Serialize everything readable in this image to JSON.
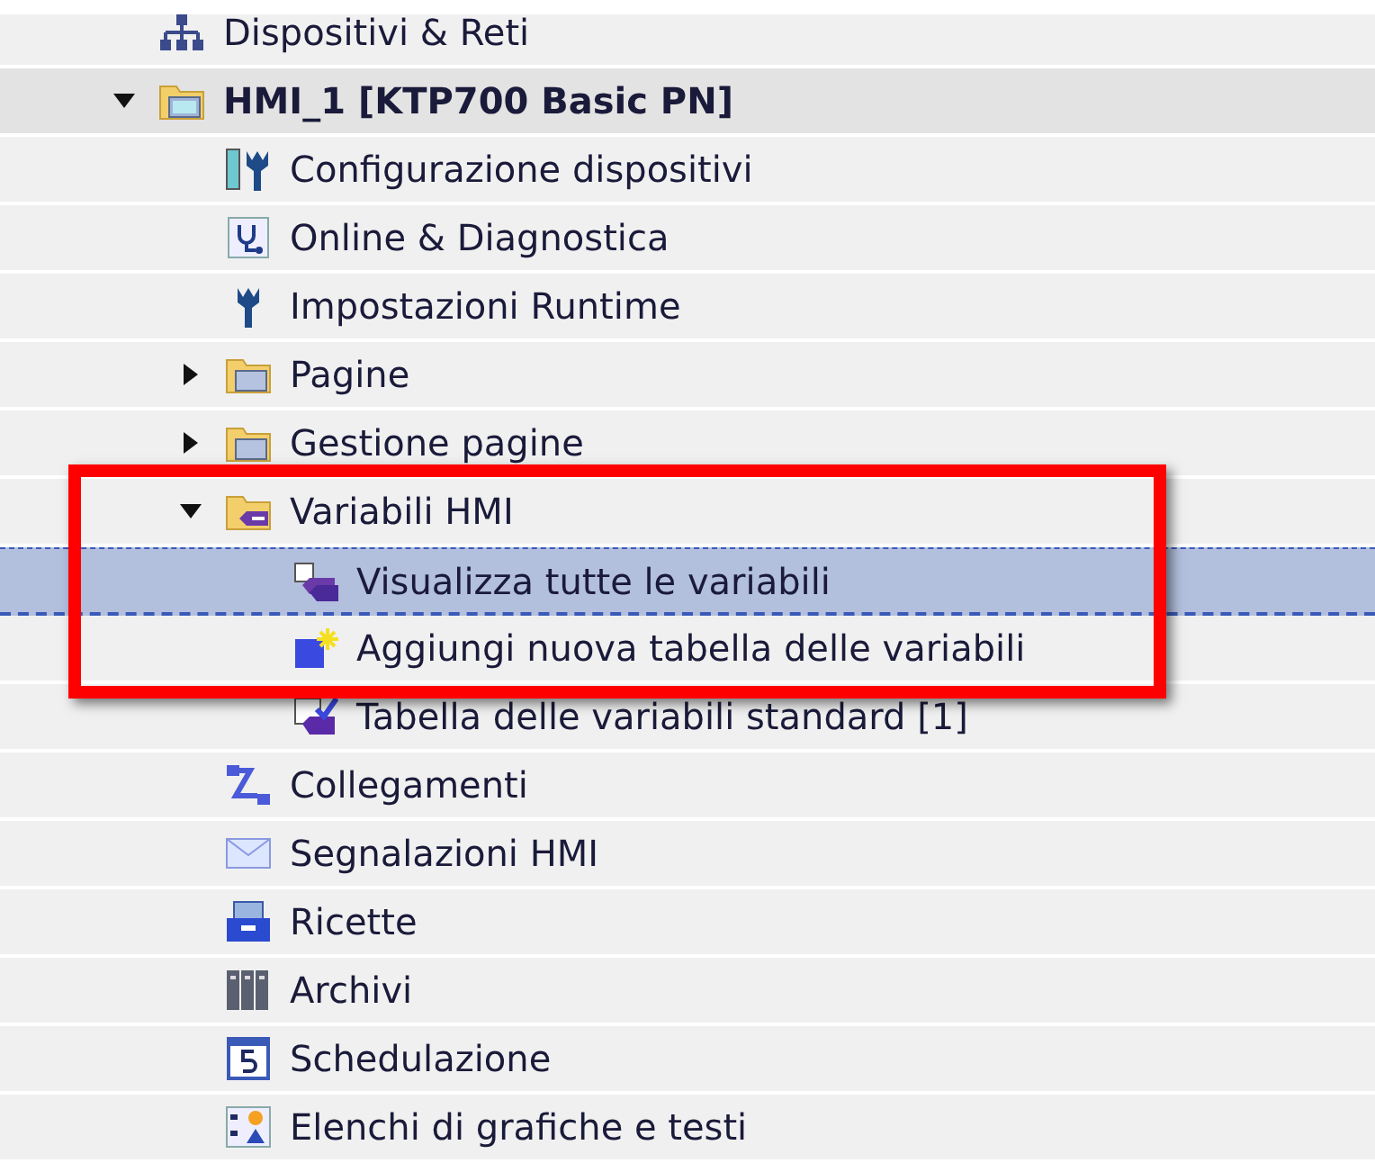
{
  "tree": [
    {
      "label": "Dispositivi & Reti",
      "kind": "network"
    },
    {
      "label": "HMI_1 [KTP700 Basic PN]",
      "kind": "device",
      "expanded": true,
      "children": [
        {
          "label": "Configurazione dispositivi",
          "kind": "config"
        },
        {
          "label": "Online & Diagnostica",
          "kind": "diagnostics"
        },
        {
          "label": "Impostazioni Runtime",
          "kind": "runtime"
        },
        {
          "label": "Pagine",
          "kind": "folder",
          "expanded": false
        },
        {
          "label": "Gestione pagine",
          "kind": "folder",
          "expanded": false
        },
        {
          "label": "Variabili HMI",
          "kind": "tagfolder",
          "expanded": true,
          "children": [
            {
              "label": "Visualizza tutte le variabili",
              "kind": "tags",
              "selected": true
            },
            {
              "label": "Aggiungi nuova tabella delle variabili",
              "kind": "add",
              "selected": false
            },
            {
              "label": "Tabella delle variabili standard [1]",
              "kind": "table",
              "selected": false
            }
          ]
        },
        {
          "label": "Collegamenti",
          "kind": "connections"
        },
        {
          "label": "Segnalazioni HMI",
          "kind": "alarms"
        },
        {
          "label": "Ricette",
          "kind": "recipes"
        },
        {
          "label": "Archivi",
          "kind": "archives"
        },
        {
          "label": "Schedulazione",
          "kind": "scheduler"
        },
        {
          "label": "Elenchi di grafiche e testi",
          "kind": "lists"
        }
      ]
    }
  ]
}
